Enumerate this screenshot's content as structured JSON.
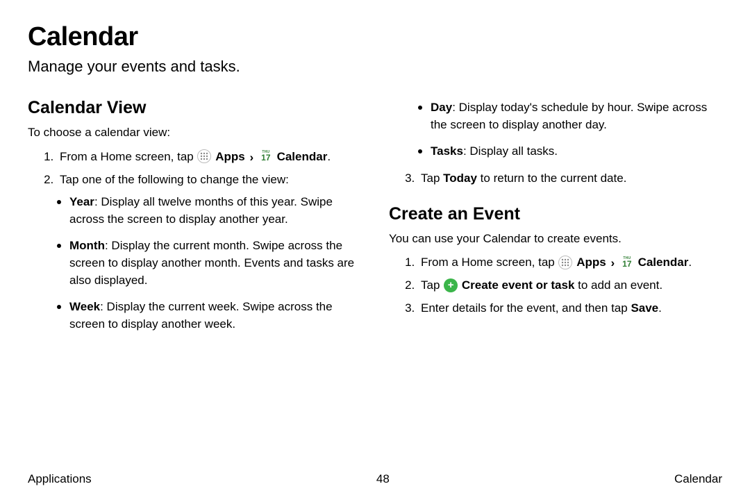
{
  "title": "Calendar",
  "subtitle": "Manage your events and tasks.",
  "calview": {
    "heading": "Calendar View",
    "intro": "To choose a calendar view:",
    "step1_pre": "From a Home screen, tap ",
    "apps_label": "Apps",
    "nav_sep": "›",
    "calendar_label": "Calendar",
    "period": ".",
    "step2": "Tap one of the following to change the view:",
    "bullets": {
      "year_b": "Year",
      "year_t": ": Display all twelve months of this year. Swipe across the screen to display another year.",
      "month_b": "Month",
      "month_t": ": Display the current month. Swipe across the screen to display another month. Events and tasks are also displayed.",
      "week_b": "Week",
      "week_t": ": Display the current week. Swipe across the screen to display another week.",
      "day_b": "Day",
      "day_t": ": Display today's schedule by hour. Swipe across the screen to display another day.",
      "tasks_b": "Tasks",
      "tasks_t": ": Display all tasks."
    },
    "step3_pre": "Tap ",
    "step3_bold": "Today",
    "step3_post": " to return to the current date."
  },
  "createevent": {
    "heading": "Create an Event",
    "intro": "You can use your Calendar to create events.",
    "step1_pre": "From a Home screen, tap ",
    "step2_pre": "Tap ",
    "step2_bold": "Create event or task",
    "step2_post": " to add an event.",
    "step3_pre": "Enter details for the event, and then tap ",
    "step3_bold": "Save",
    "step3_post": "."
  },
  "icons": {
    "cal_thu": "THU",
    "cal_num": "17",
    "plus": "+"
  },
  "footer": {
    "left": "Applications",
    "center": "48",
    "right": "Calendar"
  }
}
